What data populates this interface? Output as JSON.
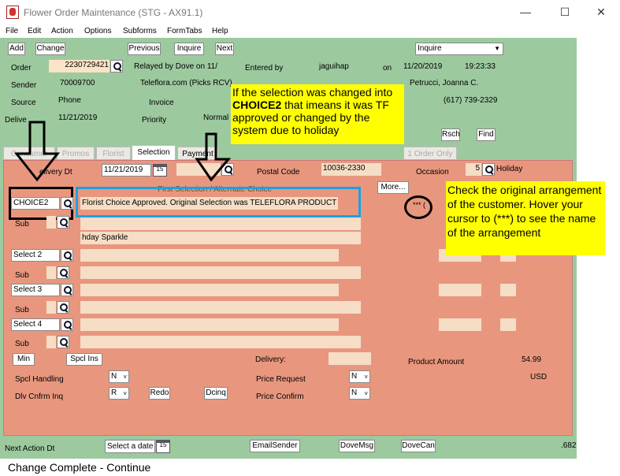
{
  "window": {
    "title": "Flower Order Maintenance (STG - AX91.1)"
  },
  "menu": [
    "File",
    "Edit",
    "Action",
    "Options",
    "Subforms",
    "FormTabs",
    "Help"
  ],
  "toolbar": {
    "add": "Add",
    "change": "Change",
    "previous": "Previous",
    "inquire": "Inquire",
    "next": "Next",
    "mode": "Inquire"
  },
  "header": {
    "order_label": "Order",
    "order_value": "2230729421",
    "relayed": "Relayed by Dove on 11/",
    "entered_by_label": "Entered by",
    "entered_by_value": "jaguihap",
    "on_label": "on",
    "entered_date": "11/20/2019",
    "entered_time": "19:23:33",
    "sender_label": "Sender",
    "sender_value": "70009700",
    "sender_name": "Teleflora.com (Picks RCV)",
    "contact_name": "Petrucci, Joanna C.",
    "source_label": "Source",
    "source_value": "Phone",
    "invoice_label": "Invoice",
    "phone": "(617) 739-2329",
    "delivery_label": "Delive",
    "delivery_date": "11/21/2019",
    "priority_label": "Priority",
    "priority_value": "Normal",
    "rsch": "Rsch",
    "find": "Find"
  },
  "tabs": [
    "Consumer",
    "Promos",
    "Florist",
    "Selection",
    "Payment",
    "1 Order Only"
  ],
  "selection": {
    "delivery_dt_label": "elivery Dt",
    "delivery_dt_value": "11/21/2019",
    "postal_label": "Postal Code",
    "postal_value": "10036-2330",
    "occasion_label": "Occasion",
    "occasion_value": "5",
    "occasion_name": "Holiday",
    "more": "More...",
    "first_selection": "First Selection / Alternate Choice",
    "choice_code": "CHOICE2",
    "choice_desc": "Florist Choice Approved. Original Selection was TELEFLORA PRODUCT",
    "stars": "*** (",
    "sub_label": "Sub",
    "sub_desc": "hday Sparkle",
    "select2": "Select 2",
    "select3": "Select 3",
    "select4": "Select 4",
    "min": "Min",
    "spcl_ins": "Spcl Ins",
    "delivery_label": "Delivery:",
    "product_amount_label": "Product Amount",
    "product_amount_value": "54.99",
    "currency": "USD",
    "spcl_handling_label": "Spcl Handling",
    "spcl_handling_value": "N",
    "dlv_cnfrm_label": "Dlv Cnfrm Inq",
    "dlv_cnfrm_value": "R",
    "redo": "Redo",
    "dcinq": "Dcinq",
    "price_request_label": "Price Request",
    "price_request_value": "N",
    "price_confirm_label": "Price Confirm",
    "price_confirm_value": "N"
  },
  "footer": {
    "next_action_label": "Next Action Dt",
    "select_date": "Select a date",
    "email_sender": "EmailSender",
    "dove_msg": "DoveMsg",
    "dove_can": "DoveCan",
    "rate": ".682"
  },
  "cal_label": "15",
  "status": "Change Complete - Continue",
  "annotations": {
    "note1": "If the selection was changed into CHOICE2 that imeans it was TF approved or changed by the system due to holiday",
    "note1_a": "If the selection was changed into ",
    "note1_b": "CHOICE2",
    "note1_c": " that imeans it was TF approved or changed by the system due to holiday",
    "note2": "Check the original arrangement of the customer. Hover your cursor to (***) to see the name of the arrangement"
  }
}
